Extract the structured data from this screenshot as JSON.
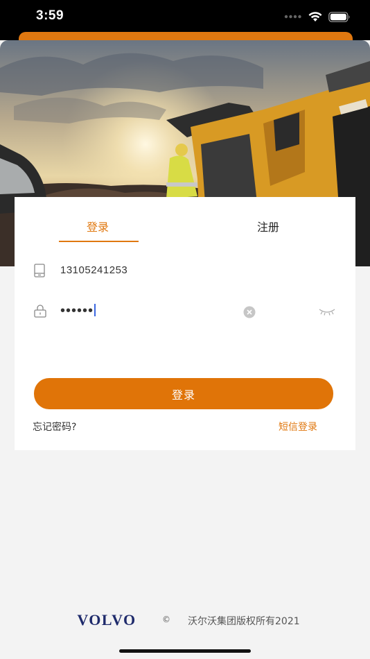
{
  "status_bar": {
    "time": "3:59"
  },
  "tabs": {
    "login": "登录",
    "register": "注册"
  },
  "form": {
    "phone_value": "13105241253",
    "password_masked": "••••••"
  },
  "login_button_label": "登录",
  "links": {
    "forgot_password": "忘记密码?",
    "sms_login": "短信登录"
  },
  "footer": {
    "brand": "VOLVO",
    "copyright_symbol": "©",
    "copyright": "沃尔沃集团版权所有2021"
  },
  "colors": {
    "accent": "#e07810",
    "background": "#f3f3f3"
  }
}
